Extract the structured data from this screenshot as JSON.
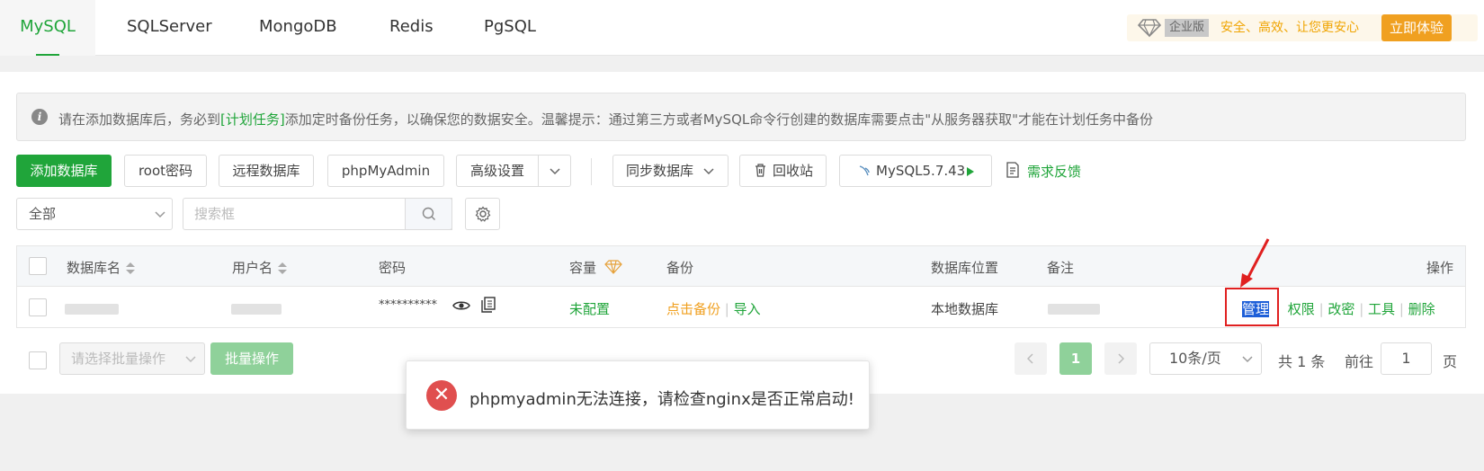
{
  "tabs": [
    "MySQL",
    "SQLServer",
    "MongoDB",
    "Redis",
    "PgSQL"
  ],
  "promo": {
    "badge": "企业版",
    "text": "安全、高效、让您更安心",
    "button": "立即体验"
  },
  "notice": {
    "prefix": "请在添加数据库后，务必到",
    "link": "[计划任务]",
    "suffix": "添加定时备份任务，以确保您的数据安全。温馨提示：通过第三方或者MySQL命令行创建的数据库需要点击\"从服务器获取\"才能在计划任务中备份"
  },
  "toolbar": {
    "add_db": "添加数据库",
    "root_pwd": "root密码",
    "remote_db": "远程数据库",
    "phpmyadmin": "phpMyAdmin",
    "advanced": "高级设置",
    "sync_db": "同步数据库",
    "recycle": "回收站",
    "version": "MySQL5.7.43",
    "feedback": "需求反馈"
  },
  "filter": {
    "category": "全部",
    "search_placeholder": "搜索框"
  },
  "table": {
    "headers": {
      "name": "数据库名",
      "user": "用户名",
      "password": "密码",
      "capacity": "容量",
      "backup": "备份",
      "location": "数据库位置",
      "remark": "备注",
      "ops": "操作"
    },
    "row": {
      "password": "**********",
      "capacity": "未配置",
      "backup_click": "点击备份",
      "backup_import": "导入",
      "location": "本地数据库",
      "ops": [
        "管理",
        "权限",
        "改密",
        "工具",
        "删除"
      ]
    }
  },
  "batch": {
    "placeholder": "请选择批量操作",
    "button": "批量操作"
  },
  "pagination": {
    "current": "1",
    "page_size": "10条/页",
    "total": "共 1 条",
    "goto_label": "前往",
    "goto_value": "1",
    "page_unit": "页"
  },
  "toast": {
    "message": "phpmyadmin无法连接，请检查nginx是否正常启动!"
  },
  "colors": {
    "accent": "#20a53a",
    "warning": "#f0a020",
    "error": "#e04f4f",
    "annotation": "#e02020"
  }
}
